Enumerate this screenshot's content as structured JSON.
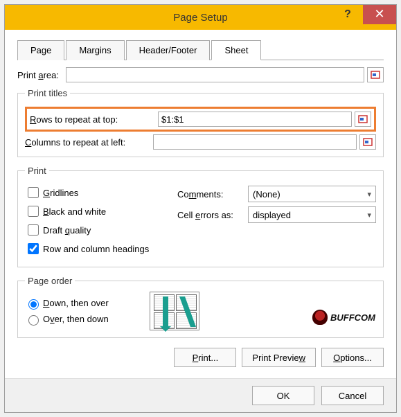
{
  "titlebar": {
    "title": "Page Setup",
    "help": "?",
    "close": "✕"
  },
  "tabs": {
    "page": "Page",
    "margins": "Margins",
    "headerfooter": "Header/Footer",
    "sheet": "Sheet"
  },
  "fields": {
    "print_area_label": "Print area:",
    "print_area_value": "",
    "print_titles_legend": "Print titles",
    "rows_label": "Rows to repeat at top:",
    "rows_value": "$1:$1",
    "cols_label": "Columns to repeat at left:",
    "cols_value": ""
  },
  "print": {
    "legend": "Print",
    "gridlines": "Gridlines",
    "bw": "Black and white",
    "draft": "Draft quality",
    "headings": "Row and column headings",
    "comments_label": "Comments:",
    "comments_value": "(None)",
    "cellerrors_label": "Cell errors as:",
    "cellerrors_value": "displayed"
  },
  "order": {
    "legend": "Page order",
    "down": "Down, then over",
    "over": "Over, then down"
  },
  "buttons": {
    "print": "Print...",
    "preview": "Print Preview",
    "options": "Options...",
    "ok": "OK",
    "cancel": "Cancel"
  },
  "watermark": "BUFFCOM"
}
